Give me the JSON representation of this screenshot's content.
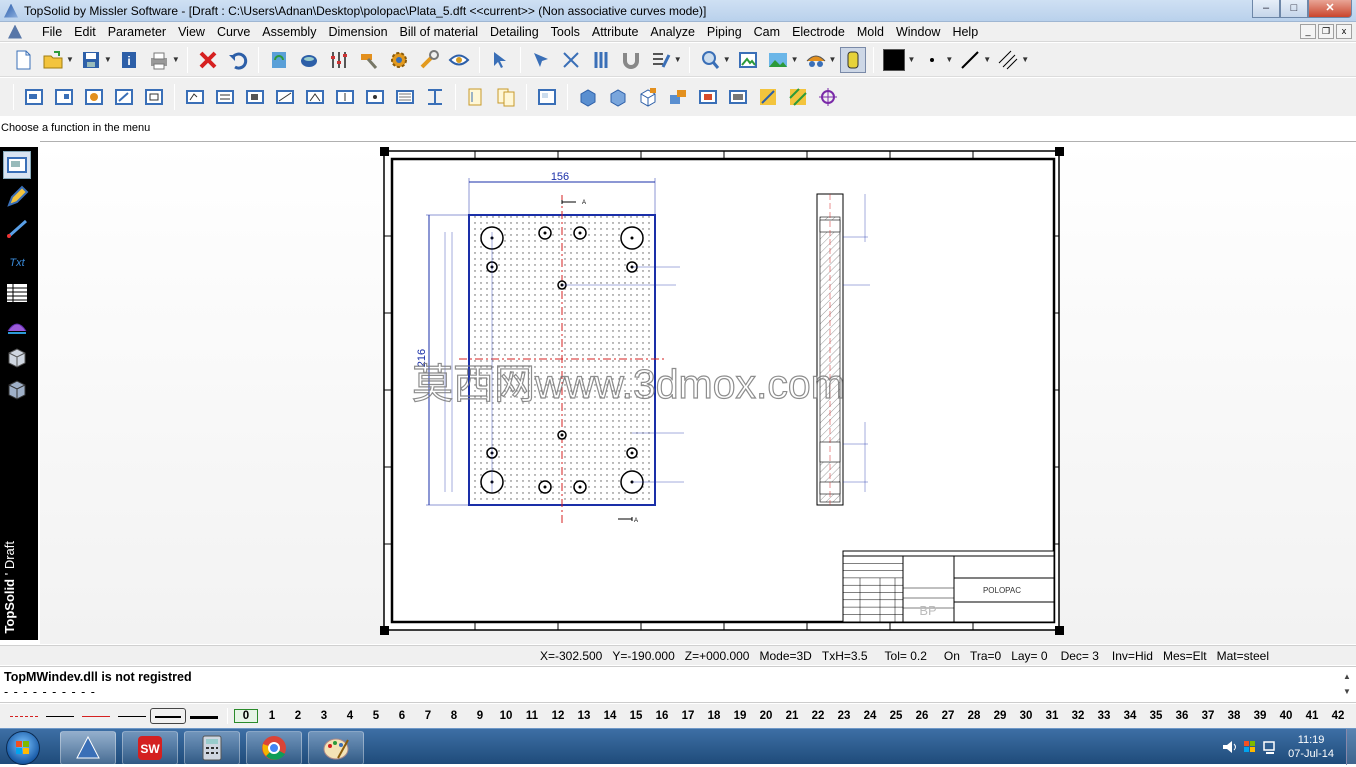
{
  "window": {
    "title": "TopSolid by Missler Software - [Draft : C:\\Users\\Adnan\\Desktop\\polopac\\Plata_5.dft  <<current>> (Non associative curves mode)]",
    "minimize": "–",
    "maximize": "□",
    "close": "✕"
  },
  "menu": [
    "File",
    "Edit",
    "Parameter",
    "View",
    "Curve",
    "Assembly",
    "Dimension",
    "Bill of material",
    "Detailing",
    "Tools",
    "Attribute",
    "Analyze",
    "Piping",
    "Cam",
    "Electrode",
    "Mold",
    "Window",
    "Help"
  ],
  "mdi": {
    "minimize": "_",
    "restore": "❐",
    "close": "x"
  },
  "hint": "Choose a function in the menu",
  "side_label": {
    "brand": "TopSolid",
    "sep": "'",
    "mode": "Draft"
  },
  "drawing": {
    "dim_width": "156",
    "dim_height": "216",
    "section_mark": "A",
    "title_block": {
      "part_name": "POLOPAC",
      "logo": "BP"
    },
    "watermark": "莫西网www.3dmox.com"
  },
  "status": {
    "x": "X=-302.500",
    "y": "Y=-190.000",
    "z": "Z=+000.000",
    "mode": "Mode=3D",
    "txh": "TxH=3.5",
    "tol": "Tol=  0.2",
    "on": "On",
    "tra": "Tra=0",
    "lay": "Lay=  0",
    "dec": "Dec= 3",
    "inv": "Inv=Hid",
    "mes": "Mes=Elt",
    "mat": "Mat=steel"
  },
  "message": {
    "text": "TopMWindev.dll is not registred",
    "dashes": "- - - - - - - - - -"
  },
  "layers": [
    "0",
    "1",
    "2",
    "3",
    "4",
    "5",
    "6",
    "7",
    "8",
    "9",
    "10",
    "11",
    "12",
    "13",
    "14",
    "15",
    "16",
    "17",
    "18",
    "19",
    "20",
    "21",
    "22",
    "23",
    "24",
    "25",
    "26",
    "27",
    "28",
    "29",
    "30",
    "31",
    "32",
    "33",
    "34",
    "35",
    "36",
    "37",
    "38",
    "39",
    "40",
    "41",
    "42"
  ],
  "taskbar": {
    "time": "11:19",
    "date": "07-Jul-14"
  },
  "colors": {
    "dimension_blue": "#1a2fa8",
    "axis_red": "#d42020",
    "toolbar_bg": "#f0f0f0"
  }
}
